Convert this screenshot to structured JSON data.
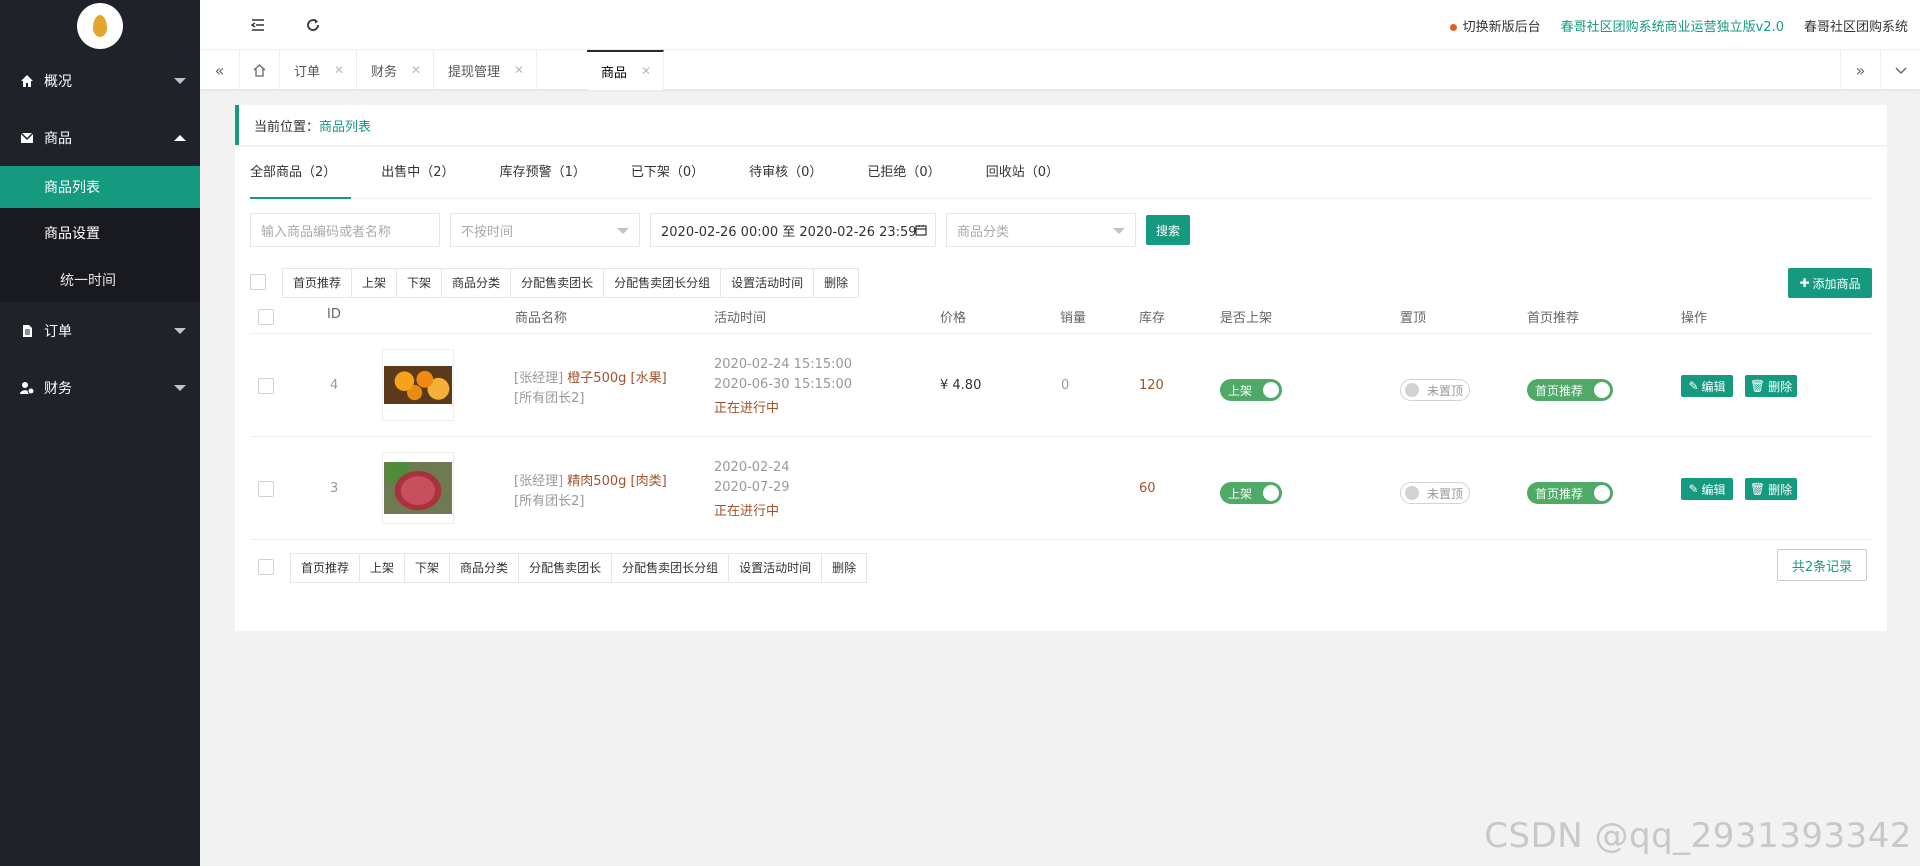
{
  "sidebar": {
    "items": [
      {
        "label": "概况",
        "icon": "home-icon"
      },
      {
        "label": "商品",
        "icon": "mail-icon"
      },
      {
        "label": "订单",
        "icon": "document-icon"
      },
      {
        "label": "财务",
        "icon": "user-money-icon"
      }
    ],
    "sub": {
      "list_label": "商品列表",
      "settings_label": "商品设置",
      "unified_time_label": "统一时间"
    }
  },
  "header": {
    "switch_label": "切换新版后台",
    "product_label": "春哥社区团购系统商业运营独立版v2.0",
    "system_label": "春哥社区团购系统"
  },
  "tabs": [
    {
      "label": "订单"
    },
    {
      "label": "财务"
    },
    {
      "label": "提现管理"
    },
    {
      "label": "商品"
    }
  ],
  "breadcrumb": {
    "prefix": "当前位置：",
    "current": "商品列表"
  },
  "filter_tabs": [
    {
      "label": "全部商品（2）"
    },
    {
      "label": "出售中（2）"
    },
    {
      "label": "库存预警（1）"
    },
    {
      "label": "已下架（0）"
    },
    {
      "label": "待审核（0）"
    },
    {
      "label": "已拒绝（0）"
    },
    {
      "label": "回收站（0）"
    }
  ],
  "search": {
    "keyword_placeholder": "输入商品编码或者名称",
    "time_select": "不按时间",
    "date_range": "2020-02-26 00:00 至 2020-02-26 23:59",
    "category_placeholder": "商品分类",
    "search_btn": "搜索"
  },
  "actions": [
    "首页推荐",
    "上架",
    "下架",
    "商品分类",
    "分配售卖团长",
    "分配售卖团长分组",
    "设置活动时间",
    "删除"
  ],
  "add_btn": "添加商品",
  "columns": [
    "ID",
    "商品名称",
    "活动时间",
    "价格",
    "销量",
    "库存",
    "是否上架",
    "置顶",
    "首页推荐",
    "操作"
  ],
  "rows": [
    {
      "id": "4",
      "manager": "[张经理]",
      "name": "橙子500g [水果]",
      "scope": "[所有团长2]",
      "start": "2020-02-24 15:15:00",
      "end": "2020-06-30 15:15:00",
      "status": "正在进行中",
      "price": "¥ 4.80",
      "sales": "0",
      "stock": "120",
      "shelf": "上架",
      "top": "未置顶",
      "recommend": "首页推荐",
      "edit": "编辑",
      "del": "删除"
    },
    {
      "id": "3",
      "manager": "[张经理]",
      "name": "精肉500g [肉类]",
      "scope": "[所有团长2]",
      "start": "2020-02-24",
      "end": "2020-07-29",
      "status": "正在进行中",
      "price": "",
      "sales": "",
      "stock": "60",
      "shelf": "上架",
      "top": "未置顶",
      "recommend": "首页推荐",
      "edit": "编辑",
      "del": "删除"
    }
  ],
  "total": "共2条记录",
  "watermark": "CSDN @qq_2931393342",
  "colors": {
    "accent": "#159a80",
    "sidebar": "#20222a",
    "switch_on": "#4faa68"
  }
}
